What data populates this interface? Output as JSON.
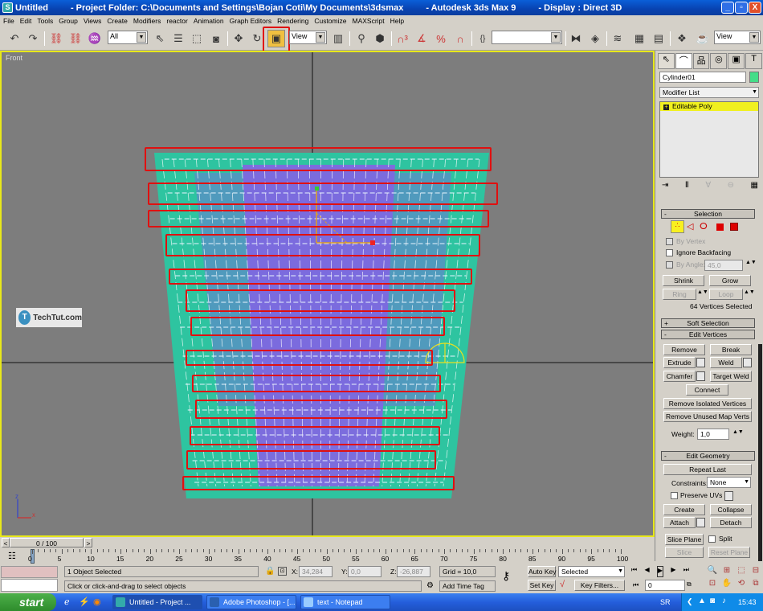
{
  "titlebar": {
    "document": "Untitled",
    "project_folder": "- Project Folder: C:\\Documents and Settings\\Bojan Coti\\My Documents\\3dsmax",
    "app": "- Autodesk 3ds Max 9",
    "display": "- Display : Direct 3D",
    "minimize": "_",
    "maximize": "▫",
    "close": "X"
  },
  "menu": [
    "File",
    "Edit",
    "Tools",
    "Group",
    "Views",
    "Create",
    "Modifiers",
    "reactor",
    "Animation",
    "Graph Editors",
    "Rendering",
    "Customize",
    "MAXScript",
    "Help"
  ],
  "toolbar": {
    "selection_filter": "All",
    "ref_coord": "View",
    "named_selection": "",
    "render_type": "View",
    "highlighted_tool": "select-and-uniform-scale"
  },
  "viewport": {
    "label": "Front",
    "watermark": "TechTut.com",
    "axis_z": "z",
    "axis_x": "x",
    "highlight_color": "#e01010",
    "mesh_color": "#2ec4a0",
    "selection_color": "#9966ff"
  },
  "command_panel": {
    "object_name": "Cylinder01",
    "object_color": "#44dd88",
    "modifier_list": "Modifier List",
    "stack_item": "Editable Poly",
    "selection": {
      "title": "Selection",
      "by_vertex": "By Vertex",
      "ignore_backfacing": "Ignore Backfacing",
      "by_angle": "By Angle:",
      "angle_value": "45,0",
      "shrink": "Shrink",
      "grow": "Grow",
      "ring": "Ring",
      "loop": "Loop",
      "status": "64 Vertices Selected"
    },
    "soft_selection": {
      "title": "Soft Selection"
    },
    "edit_vertices": {
      "title": "Edit Vertices",
      "remove": "Remove",
      "break": "Break",
      "extrude": "Extrude",
      "weld": "Weld",
      "chamfer": "Chamfer",
      "target_weld": "Target Weld",
      "connect": "Connect",
      "remove_isolated": "Remove Isolated Vertices",
      "remove_unused": "Remove Unused Map Verts",
      "weight_label": "Weight:",
      "weight_value": "1,0"
    },
    "edit_geometry": {
      "title": "Edit Geometry",
      "repeat_last": "Repeat Last",
      "constraints_label": "Constraints:",
      "constraints_value": "None",
      "preserve_uvs": "Preserve UVs",
      "create": "Create",
      "collapse": "Collapse",
      "attach": "Attach",
      "detach": "Detach",
      "slice_plane": "Slice Plane",
      "split": "Split",
      "slice": "Slice",
      "reset_plane": "Reset Plane"
    }
  },
  "timeline": {
    "frame_display": "0 / 100",
    "prev": "<",
    "next": ">",
    "ticks": [
      "0",
      "5",
      "10",
      "15",
      "20",
      "25",
      "30",
      "35",
      "40",
      "45",
      "50",
      "55",
      "60",
      "65",
      "70",
      "75",
      "80",
      "85",
      "90",
      "95",
      "100"
    ]
  },
  "status": {
    "selection_info": "1 Object Selected",
    "prompt": "Click or click-and-drag to select objects",
    "x_label": "X:",
    "x_value": "34,284",
    "y_label": "Y:",
    "y_value": "0,0",
    "z_label": "Z:",
    "z_value": "-26,887",
    "grid": "Grid = 10,0",
    "add_time_tag": "Add Time Tag",
    "auto_key": "Auto Key",
    "set_key": "Set Key",
    "key_mode": "Selected",
    "key_filters": "Key Filters...",
    "current_frame": "0"
  },
  "taskbar": {
    "start": "start",
    "tasks": [
      "Untitled    - Project ...",
      "Adobe Photoshop - [...",
      "text - Notepad"
    ],
    "lang": "SR",
    "clock": "15:43"
  }
}
